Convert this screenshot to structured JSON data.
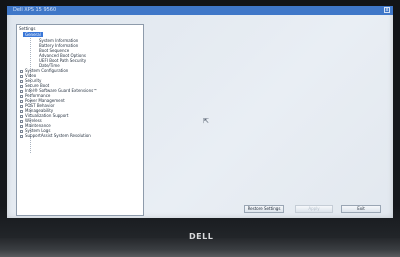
{
  "window": {
    "title": "Dell XPS 15 9560",
    "close_symbol": "x"
  },
  "tree": {
    "root_label": "Settings",
    "items": [
      {
        "label": "General",
        "level": 1,
        "expanded": true,
        "selected": true
      },
      {
        "label": "System Information",
        "level": 2
      },
      {
        "label": "Battery Information",
        "level": 2
      },
      {
        "label": "Boot Sequence",
        "level": 2
      },
      {
        "label": "Advanced Boot Options",
        "level": 2
      },
      {
        "label": "UEFI Boot Path Security",
        "level": 2
      },
      {
        "label": "Date/Time",
        "level": 2
      },
      {
        "label": "System Configuration",
        "level": 1
      },
      {
        "label": "Video",
        "level": 1
      },
      {
        "label": "Security",
        "level": 1
      },
      {
        "label": "Secure Boot",
        "level": 1
      },
      {
        "label": "Intel® Software Guard Extensions™",
        "level": 1
      },
      {
        "label": "Performance",
        "level": 1
      },
      {
        "label": "Power Management",
        "level": 1
      },
      {
        "label": "POST Behavior",
        "level": 1
      },
      {
        "label": "Manageability",
        "level": 1
      },
      {
        "label": "Virtualization Support",
        "level": 1
      },
      {
        "label": "Wireless",
        "level": 1
      },
      {
        "label": "Maintenance",
        "level": 1
      },
      {
        "label": "System Logs",
        "level": 1
      },
      {
        "label": "SupportAssist System Resolution",
        "level": 1
      }
    ]
  },
  "buttons": {
    "restore": "Restore Settings",
    "apply": "Apply",
    "exit": "Exit"
  },
  "branding": {
    "logo_text": "DELL"
  },
  "icons": [
    "close-icon",
    "expander-icon",
    "mouse-pointer-icon"
  ]
}
